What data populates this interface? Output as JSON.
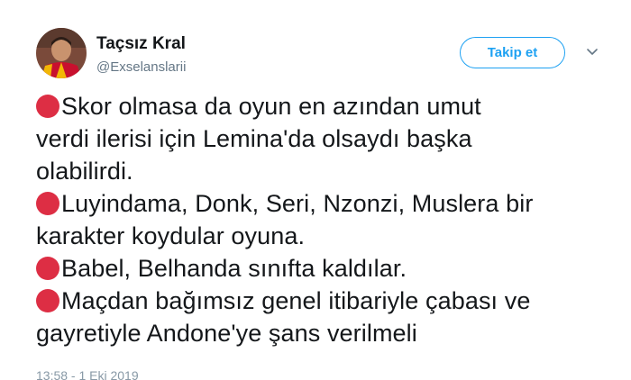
{
  "author": {
    "display_name": "Taçsız Kral",
    "handle": "@Exselanslarii",
    "avatar_icon": "avatar-photo"
  },
  "follow_button": {
    "label": "Takip et"
  },
  "menu": {
    "icon": "chevron-down-icon"
  },
  "tweet": {
    "paragraphs": [
      {
        "bullet": "red-circle-emoji",
        "lines": [
          "Skor olmasa da oyun en azından umut",
          "verdi ilerisi için Lemina'da olsaydı başka",
          "olabilirdi."
        ]
      },
      {
        "bullet": "red-circle-emoji",
        "lines": [
          "Luyindama, Donk, Seri, Nzonzi, Muslera bir",
          "karakter koydular oyuna."
        ]
      },
      {
        "bullet": "red-circle-emoji",
        "lines": [
          "Babel, Belhanda sınıfta kaldılar."
        ]
      },
      {
        "bullet": "red-circle-emoji",
        "lines": [
          "Maçdan bağımsız genel itibariyle çabası ve",
          "gayretiyle Andone'ye şans verilmeli"
        ]
      }
    ],
    "timestamp": "13:58 - 1 Eki 2019"
  },
  "colors": {
    "accent": "#1da1f2",
    "bullet": "#dd2e44",
    "text": "#14171a",
    "secondary": "#657786"
  }
}
